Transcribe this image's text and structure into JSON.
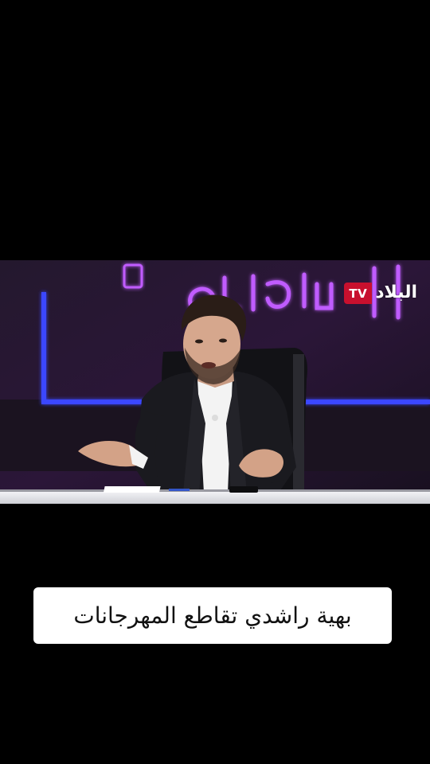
{
  "video": {
    "channel_logo": {
      "tv_label": "TV",
      "name": "البلاد"
    }
  },
  "caption": {
    "text": "بهية راشدي تقاطع المهرجانات"
  },
  "colors": {
    "background": "#000000",
    "caption_box": "#ffffff",
    "caption_text": "#111111",
    "logo_red": "#c8102e",
    "neon_purple": "#b24bff",
    "neon_blue": "#2c3cff",
    "studio_desk": "#e9e9ee"
  }
}
